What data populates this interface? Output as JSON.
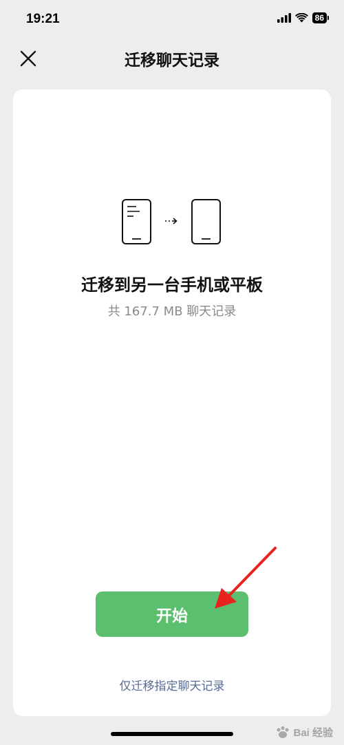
{
  "status_bar": {
    "time": "19:21",
    "battery_level": "86",
    "icons": [
      "signal-icon",
      "wifi-icon",
      "battery-icon"
    ]
  },
  "nav": {
    "title": "迁移聊天记录",
    "close_icon": "close-icon"
  },
  "card": {
    "illustration_icon": "phone-to-phone-transfer-icon",
    "headline": "迁移到另一台手机或平板",
    "subtitle": "共 167.7 MB 聊天记录",
    "start_button_label": "开始",
    "secondary_link_label": "仅迁移指定聊天记录"
  },
  "annotation": {
    "arrow_color": "#e8231e"
  },
  "watermark": {
    "text": "Bai 经验"
  },
  "colors": {
    "background": "#ededed",
    "card": "#ffffff",
    "primary_button": "#5bbf6f",
    "link": "#576b95",
    "subtitle": "#8a8a8a"
  }
}
